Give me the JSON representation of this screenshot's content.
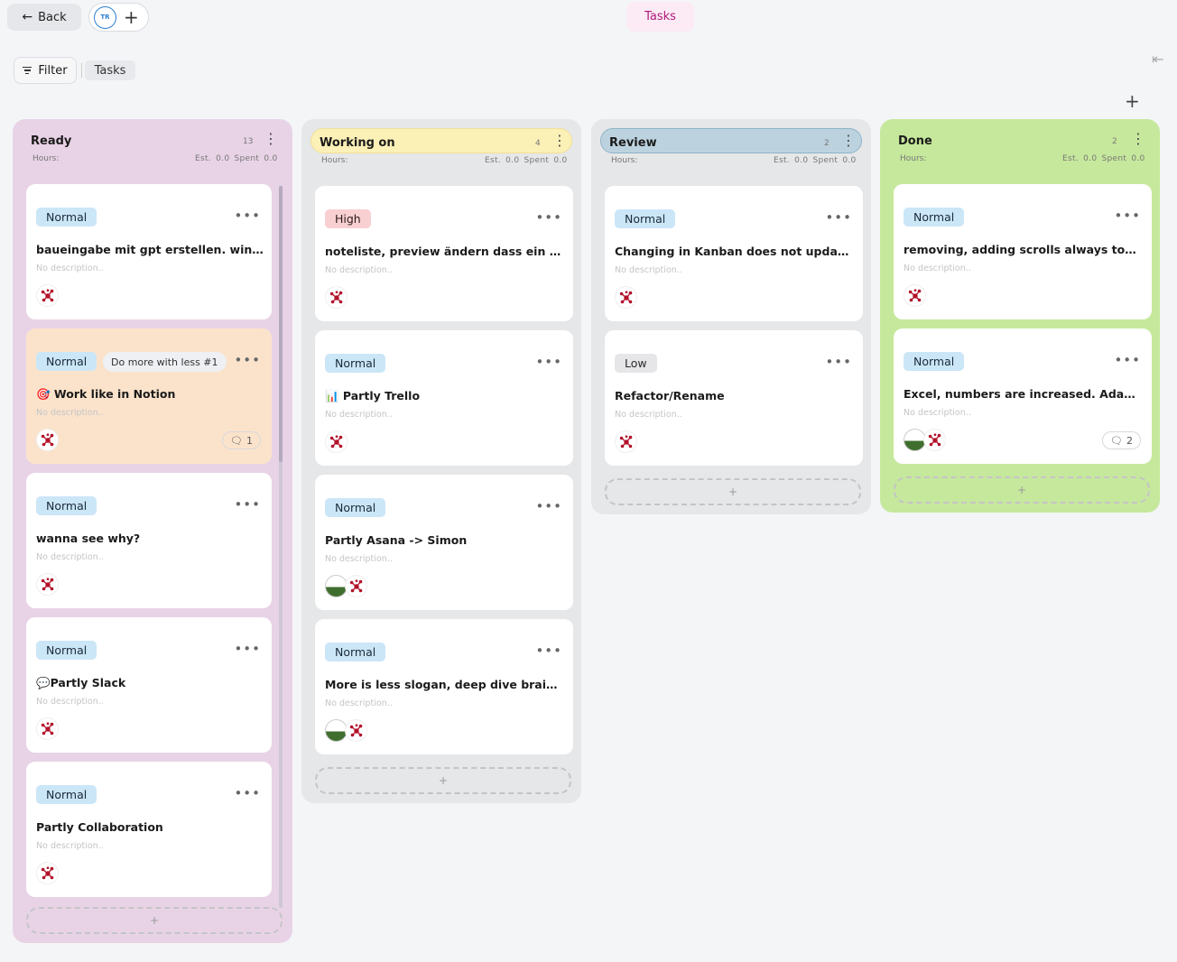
{
  "topbar": {
    "back_label": "Back",
    "member_initials": "TR",
    "add_member": "+",
    "active_tab": "Tasks"
  },
  "toolbar": {
    "filter_label": "Filter",
    "view_label": "Tasks",
    "add_column": "+",
    "collapse_icon": "collapse-arrow-icon"
  },
  "colors": {
    "ready": "#e8d3e6",
    "working_on_bg": "#e6e7e9",
    "working_on_header": "#fbf0b6",
    "review_bg": "#e6e7e9",
    "review_header": "#bcd3df",
    "done": "#c6e89c",
    "highlight_card": "#fbe3cb"
  },
  "board": {
    "columns": [
      {
        "title": "Ready",
        "count": "13",
        "hours_label": "Hours:",
        "est_label": "Est. 0.0  Spent 0.0",
        "add_label": "+",
        "cards": [
          {
            "priority": "Normal",
            "title": "baueingabe mit gpt erstellen. windfang",
            "desc": "No description..",
            "avatars": [
              "x"
            ]
          },
          {
            "priority": "Normal",
            "goal": "Do more with less #1",
            "title": "🎯 Work like in Notion",
            "desc": "No description..",
            "avatars": [
              "x"
            ],
            "comments": "1"
          },
          {
            "priority": "Normal",
            "title": "wanna see why?",
            "desc": "No description..",
            "avatars": [
              "x"
            ]
          },
          {
            "priority": "Normal",
            "title": "💬Partly Slack",
            "desc": "No description..",
            "avatars": [
              "x"
            ]
          },
          {
            "priority": "Normal",
            "title": "Partly Collaboration",
            "desc": "No description..",
            "avatars": [
              "x"
            ]
          }
        ]
      },
      {
        "title": "Working on",
        "count": "4",
        "hours_label": "Hours:",
        "est_label": "Est. 0.0  Spent 0.0",
        "add_label": "+",
        "cards": [
          {
            "priority": "High",
            "title": "noteliste, preview ändern dass ein bild, text",
            "desc": "No description..",
            "avatars": [
              "x"
            ]
          },
          {
            "priority": "Normal",
            "title": "📊 Partly Trello",
            "desc": "No description..",
            "avatars": [
              "x"
            ]
          },
          {
            "priority": "Normal",
            "title": "Partly Asana -> Simon",
            "desc": "No description..",
            "avatars": [
              "flag",
              "x"
            ]
          },
          {
            "priority": "Normal",
            "title": "More is less slogan, deep dive brainstorming",
            "desc": "No description..",
            "avatars": [
              "flag",
              "x"
            ]
          }
        ]
      },
      {
        "title": "Review",
        "count": "2",
        "hours_label": "Hours:",
        "est_label": "Est. 0.0  Spent 0.0",
        "add_label": "+",
        "cards": [
          {
            "priority": "Normal",
            "title": "Changing in Kanban does not update It's status",
            "desc": "No description..",
            "avatars": [
              "x"
            ]
          },
          {
            "priority": "Low",
            "title": "Refactor/Rename",
            "desc": "No description..",
            "avatars": [
              "x"
            ]
          }
        ]
      },
      {
        "title": "Done",
        "count": "2",
        "hours_label": "Hours:",
        "est_label": "Est. 0.0  Spent 0.0",
        "add_label": "+",
        "cards": [
          {
            "priority": "Normal",
            "title": "removing, adding scrolls always to the top",
            "desc": "No description..",
            "avatars": [
              "x"
            ]
          },
          {
            "priority": "Normal",
            "title": "Excel, numbers are increased. Adapt.",
            "desc": "No description..",
            "avatars": [
              "flag",
              "x"
            ],
            "comments": "2"
          }
        ]
      }
    ]
  }
}
